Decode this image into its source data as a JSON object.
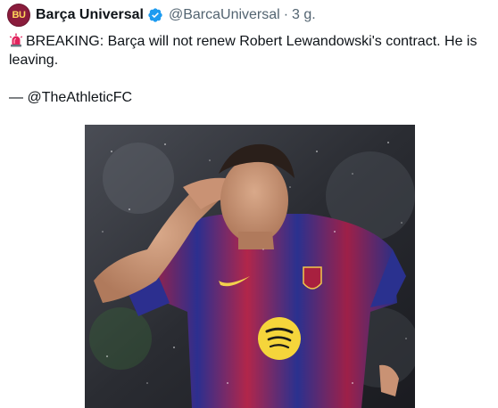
{
  "tweet": {
    "author": {
      "display_name": "Barça Universal",
      "handle": "@BarcaUniversal",
      "avatar_text": "BU",
      "verified": true
    },
    "separator": "·",
    "time": "3 g.",
    "text_line1": "BREAKING: Barça will not renew Robert Lewandowski's contract. He is leaving.",
    "text_line2": "— @TheAthleticFC",
    "media": {
      "type": "photo",
      "icon": "photo-image"
    }
  },
  "colors": {
    "verified_blue": "#1d9bf0",
    "avatar_bg": "#8a1c3c",
    "text_primary": "#0f1419",
    "text_secondary": "#536471",
    "siren_red": "#e0245e"
  }
}
